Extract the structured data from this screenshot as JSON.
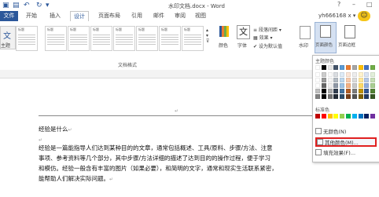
{
  "title_bar": {
    "document_title": "水印文档.docx - Word",
    "help": "?",
    "minimize": "–",
    "restore": "□"
  },
  "tabs": [
    {
      "label": "文件"
    },
    {
      "label": "开始"
    },
    {
      "label": "插入"
    },
    {
      "label": "设计"
    },
    {
      "label": "页面布局"
    },
    {
      "label": "引用"
    },
    {
      "label": "邮件"
    },
    {
      "label": "审阅"
    },
    {
      "label": "视图"
    }
  ],
  "user": "yh666168 x ▾",
  "ribbon": {
    "theme_label": "主题",
    "doc_format_label": "文档格式",
    "style_heading": "标题",
    "para_spacing": "段落间距 ▾",
    "effects": "效果 ▾",
    "set_default": "设为默认值",
    "colors": "颜色",
    "fonts": "字体",
    "watermark": "水印",
    "page_color": "页面颜色",
    "page_border": "页面边框",
    "font_glyph": "文"
  },
  "document": {
    "heading": "经验是什么",
    "body_lines": [
      "经验是一篇能指导人们达到某种目的的文章，通常包括概述、工具/原料、步骤/方法、注意",
      "事项、参考资料等几个部分，其中步骤/方法详细的描述了达到目的的操作过程，便于学习",
      "和模仿。经验一般含有丰富的图片（如果必要），和简明的文字，通常和现实生活联系紧密，",
      "能帮助人们解决实际问题。"
    ],
    "para_mark": "↵"
  },
  "page_color_menu": {
    "theme_colors_label": "主题颜色",
    "standard_colors_label": "标准色",
    "no_color": "无颜色(N)",
    "more_colors": "其他颜色(M)...",
    "fill_effects": "填充效果(F)...",
    "theme_top_row": [
      "#ffffff",
      "#000000",
      "#e7e6e6",
      "#44546a",
      "#5b9bd5",
      "#ed7d31",
      "#a5a5a5",
      "#ffc000",
      "#4472c4",
      "#70ad47"
    ],
    "standard_row": [
      "#c00000",
      "#ff0000",
      "#ffc000",
      "#ffff00",
      "#92d050",
      "#00b050",
      "#00b0f0",
      "#0070c0",
      "#002060",
      "#7030a0"
    ]
  }
}
